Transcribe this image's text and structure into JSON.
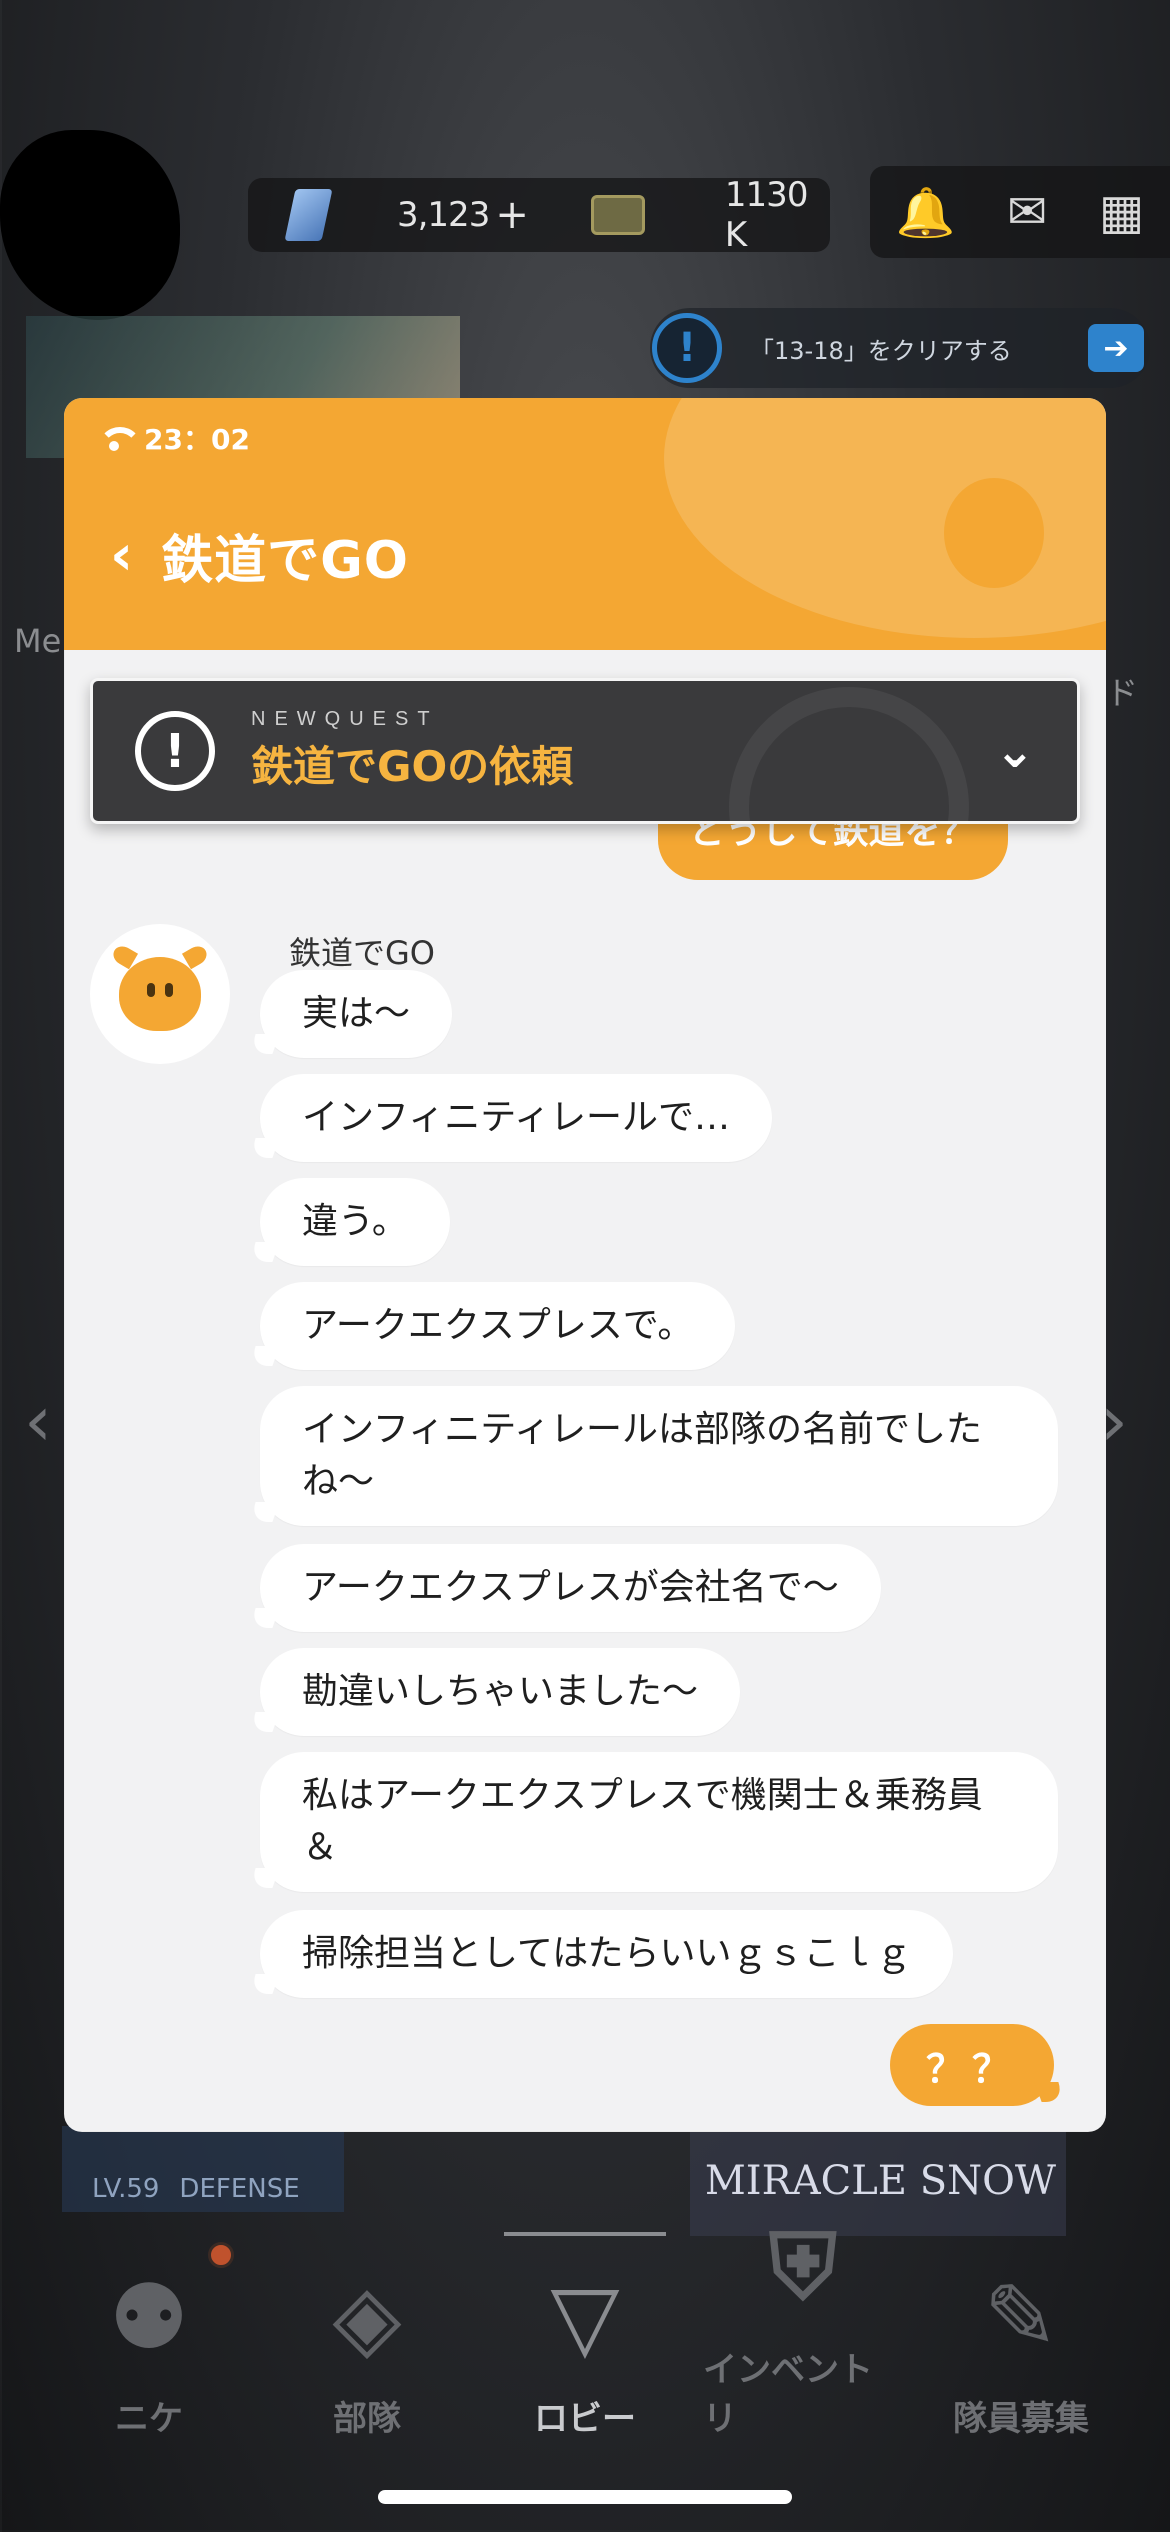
{
  "hud": {
    "gem_count": "3,123",
    "gem_plus": "+",
    "credit_count": "1130 K"
  },
  "quest_notice": {
    "text": "「13-18」をクリアする"
  },
  "side": {
    "left_label": "Me",
    "right_label": "ド"
  },
  "tiles": {
    "defense_level": "LV.59",
    "defense_label": "DEFENSE",
    "miracle_label": "MIRACLE SNOW"
  },
  "status_bar": {
    "time": "23：02"
  },
  "chat": {
    "title": "鉄道でGO",
    "quest_tag": "NEWQUEST",
    "quest_name": "鉄道でGOの依頼",
    "hidden_outgoing": "どうして鉄道を？",
    "sender": "鉄道でGO",
    "messages": [
      "実は〜",
      "インフィニティレールで…",
      "違う。",
      "アークエクスプレスで。",
      "インフィニティレールは部隊の名前でしたね〜",
      "アークエクスプレスが会社名で〜",
      "勘違いしちゃいました〜",
      "私はアークエクスプレスで機関士＆乗務員＆",
      "掃除担当としてはたらいいｇｓこｌｇ"
    ],
    "reply": "？？"
  },
  "bottom_nav": {
    "items": [
      {
        "label": "ニケ",
        "icon": "nikke-icon"
      },
      {
        "label": "部隊",
        "icon": "squad-icon"
      },
      {
        "label": "ロビー",
        "icon": "lobby-icon"
      },
      {
        "label": "インベントリ",
        "icon": "inventory-icon"
      },
      {
        "label": "隊員募集",
        "icon": "recruit-icon"
      }
    ],
    "active": "ロビー"
  },
  "colors": {
    "accent": "#f4a733",
    "quest_card": "#3a3a3c",
    "quest_name": "#f6b440"
  }
}
